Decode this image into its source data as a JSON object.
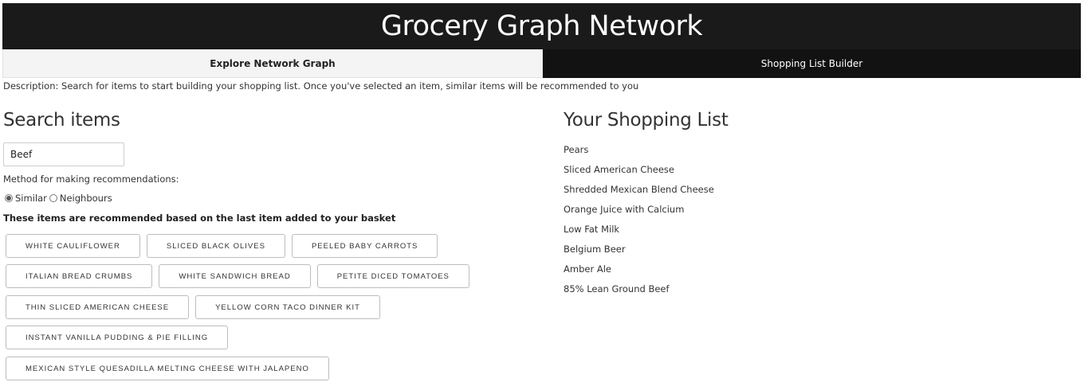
{
  "header": {
    "title": "Grocery Graph Network"
  },
  "tabs": [
    {
      "label": "Explore Network Graph",
      "active": true
    },
    {
      "label": "Shopping List Builder",
      "active": false
    }
  ],
  "description": "Description: Search for items to start building your shopping list. Once you've selected an item, similar items will be recommended to you",
  "search": {
    "title": "Search items",
    "value": "Beef",
    "method_label": "Method for making recommendations:",
    "methods": [
      {
        "label": "Similar",
        "selected": true
      },
      {
        "label": "Neighbours",
        "selected": false
      }
    ]
  },
  "recommendations": {
    "heading": "These items are recommended based on the last item added to your basket",
    "rows": [
      [
        "WHITE CAULIFLOWER",
        "SLICED BLACK OLIVES",
        "PEELED BABY CARROTS"
      ],
      [
        "ITALIAN BREAD CRUMBS",
        "WHITE SANDWICH BREAD",
        "PETITE DICED TOMATOES"
      ],
      [
        "THIN SLICED AMERICAN CHEESE",
        "YELLOW CORN TACO DINNER KIT"
      ],
      [
        "INSTANT VANILLA PUDDING & PIE FILLING"
      ],
      [
        "MEXICAN STYLE QUESADILLA MELTING CHEESE WITH JALAPENO"
      ]
    ]
  },
  "shopping_list": {
    "title": "Your Shopping List",
    "items": [
      "Pears",
      "Sliced American Cheese",
      "Shredded Mexican Blend Cheese",
      "Orange Juice with Calcium",
      "Low Fat Milk",
      "Belgium Beer",
      "Amber Ale",
      "85% Lean Ground Beef"
    ]
  }
}
